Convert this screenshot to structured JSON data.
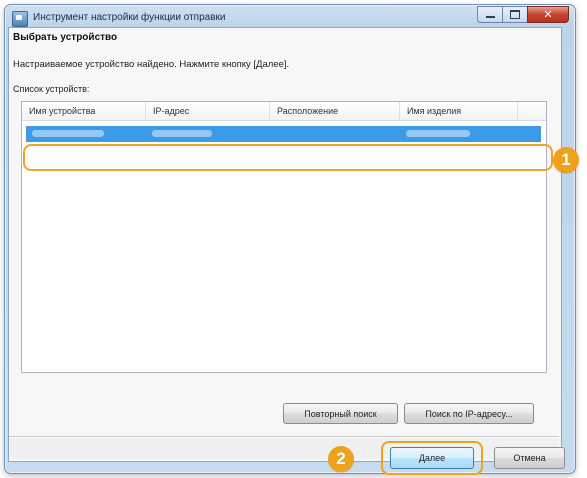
{
  "window": {
    "title": "Инструмент настройки функции отправки",
    "controls": [
      "minimize",
      "maximize",
      "close"
    ]
  },
  "main": {
    "heading": "Выбрать устройство",
    "instruction": "Настраиваемое устройство найдено. Нажмите кнопку [Далее].",
    "list_label": "Список устройств:"
  },
  "device_list": {
    "columns": [
      "Имя устройства",
      "IP-адрес",
      "Расположение",
      "Имя изделия"
    ],
    "selected_row": {
      "state": "selected (contents blurred)"
    }
  },
  "buttons": {
    "research": "Повторный поиск",
    "ip_search": "Поиск по IP-адресу...",
    "next": "Далее",
    "cancel": "Отмена"
  },
  "callouts": {
    "one": "1",
    "two": "2"
  },
  "colors": {
    "accent": "#eea21c",
    "selection": "#3c9ae8"
  }
}
